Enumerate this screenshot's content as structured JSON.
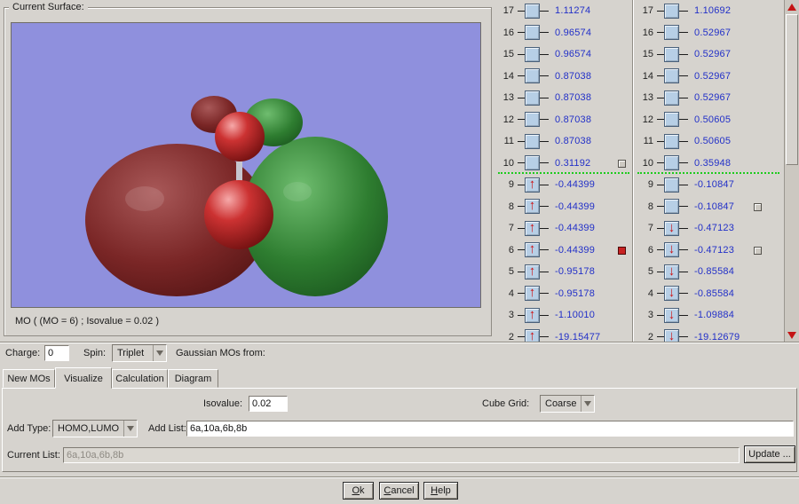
{
  "surface_panel": {
    "title": "Current Surface:",
    "caption": "MO ( (MO = 6) ; Isovalue = 0.02 )",
    "canvas_color": "#8f90dd",
    "lobe_colors": {
      "positive": "#7a2626",
      "negative": "#2e7d30",
      "atom": "#cc2222"
    }
  },
  "mo_panel": {
    "value_color": "#2230c8",
    "homo_line_color": "#1ecb1e",
    "columns": [
      {
        "name": "alpha",
        "homo_line_after_row": 10,
        "rows": [
          {
            "n": "17",
            "value": "1.11274",
            "arrow": "none",
            "marker": "none"
          },
          {
            "n": "16",
            "value": "0.96574",
            "arrow": "none",
            "marker": "none"
          },
          {
            "n": "15",
            "value": "0.96574",
            "arrow": "none",
            "marker": "none"
          },
          {
            "n": "14",
            "value": "0.87038",
            "arrow": "none",
            "marker": "none"
          },
          {
            "n": "13",
            "value": "0.87038",
            "arrow": "none",
            "marker": "none"
          },
          {
            "n": "12",
            "value": "0.87038",
            "arrow": "none",
            "marker": "none"
          },
          {
            "n": "11",
            "value": "0.87038",
            "arrow": "none",
            "marker": "none"
          },
          {
            "n": "10",
            "value": "0.31192",
            "arrow": "none",
            "marker": "gray"
          },
          {
            "n": "9",
            "value": "-0.44399",
            "arrow": "up",
            "marker": "none"
          },
          {
            "n": "8",
            "value": "-0.44399",
            "arrow": "up",
            "marker": "none"
          },
          {
            "n": "7",
            "value": "-0.44399",
            "arrow": "up",
            "marker": "none"
          },
          {
            "n": "6",
            "value": "-0.44399",
            "arrow": "up",
            "marker": "red"
          },
          {
            "n": "5",
            "value": "-0.95178",
            "arrow": "up",
            "marker": "none"
          },
          {
            "n": "4",
            "value": "-0.95178",
            "arrow": "up",
            "marker": "none"
          },
          {
            "n": "3",
            "value": "-1.10010",
            "arrow": "up",
            "marker": "none"
          },
          {
            "n": "2",
            "value": "-19.15477",
            "arrow": "up",
            "marker": "none"
          }
        ]
      },
      {
        "name": "beta",
        "homo_line_after_row": 10,
        "rows": [
          {
            "n": "17",
            "value": "1.10692",
            "arrow": "none",
            "marker": "none"
          },
          {
            "n": "16",
            "value": "0.52967",
            "arrow": "none",
            "marker": "none"
          },
          {
            "n": "15",
            "value": "0.52967",
            "arrow": "none",
            "marker": "none"
          },
          {
            "n": "14",
            "value": "0.52967",
            "arrow": "none",
            "marker": "none"
          },
          {
            "n": "13",
            "value": "0.52967",
            "arrow": "none",
            "marker": "none"
          },
          {
            "n": "12",
            "value": "0.50605",
            "arrow": "none",
            "marker": "none"
          },
          {
            "n": "11",
            "value": "0.50605",
            "arrow": "none",
            "marker": "none"
          },
          {
            "n": "10",
            "value": "0.35948",
            "arrow": "none",
            "marker": "none"
          },
          {
            "n": "9",
            "value": "-0.10847",
            "arrow": "none",
            "marker": "none"
          },
          {
            "n": "8",
            "value": "-0.10847",
            "arrow": "none",
            "marker": "gray"
          },
          {
            "n": "7",
            "value": "-0.47123",
            "arrow": "down",
            "marker": "none"
          },
          {
            "n": "6",
            "value": "-0.47123",
            "arrow": "down",
            "marker": "gray"
          },
          {
            "n": "5",
            "value": "-0.85584",
            "arrow": "down",
            "marker": "none"
          },
          {
            "n": "4",
            "value": "-0.85584",
            "arrow": "down",
            "marker": "none"
          },
          {
            "n": "3",
            "value": "-1.09884",
            "arrow": "down",
            "marker": "none"
          },
          {
            "n": "2",
            "value": "-19.12679",
            "arrow": "down",
            "marker": "none"
          }
        ]
      }
    ]
  },
  "controls": {
    "charge_label": "Charge:",
    "charge_value": "0",
    "spin_label": "Spin:",
    "spin_value": "Triplet",
    "gaussian_label": "Gaussian MOs from:"
  },
  "tabs": [
    {
      "label": "New MOs",
      "active": false
    },
    {
      "label": "Visualize",
      "active": true
    },
    {
      "label": "Calculation",
      "active": false
    },
    {
      "label": "Diagram",
      "active": false
    }
  ],
  "visualize_tab": {
    "isovalue_label": "Isovalue:",
    "isovalue_value": "0.02",
    "cube_grid_label": "Cube Grid:",
    "cube_grid_value": "Coarse",
    "add_type_label": "Add Type:",
    "add_type_value": "HOMO,LUMO",
    "add_list_label": "Add List:",
    "add_list_value": "6a,10a,6b,8b",
    "current_list_label": "Current List:",
    "current_list_value": "6a,10a,6b,8b",
    "update_button": "Update ..."
  },
  "footer": {
    "ok": "Ok",
    "cancel": "Cancel",
    "help": "Help"
  }
}
